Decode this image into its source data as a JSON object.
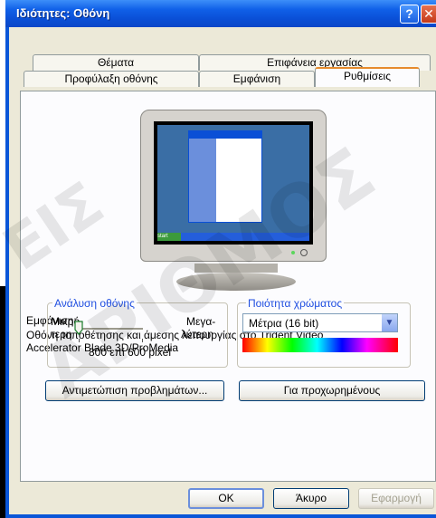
{
  "window": {
    "title": "Ιδιότητες: Οθόνη",
    "help_glyph": "?",
    "close_glyph": "✕"
  },
  "tabs": {
    "row1": [
      "Θέματα",
      "Επιφάνεια εργασίας"
    ],
    "row2": [
      "Προφύλαξη οθόνης",
      "Εμφάνιση",
      "Ρυθμίσεις"
    ],
    "active": "Ρυθμίσεις"
  },
  "display": {
    "label": "Εμφάνιση:",
    "description_line1": "Οθόνη τοποθέτησης και άμεσης λειτουργίας στο Trident Video",
    "description_line2": "Accelerator Blade 3D/ProMedia"
  },
  "resolution": {
    "group_label": "Ανάλυση οθόνης",
    "less_label_1": "Μικρό-",
    "less_label_2": "τερη",
    "more_label_1": "Μεγα-",
    "more_label_2": "λύτερη",
    "value": "800 επί 600 pixel",
    "slider_level": 0.0
  },
  "color": {
    "group_label": "Ποιότητα χρώματος",
    "selected": "Μέτρια (16 bit)"
  },
  "buttons": {
    "troubleshoot": "Αντιμετώπιση προβλημάτων...",
    "advanced": "Για προχωρημένους",
    "ok": "OK",
    "cancel": "Άκυρο",
    "apply": "Εφαρμογή"
  },
  "watermark": {
    "line1": "ΕΙΣ",
    "line2": "ΑΡΙΘΜΟΣ"
  },
  "preview": {
    "start_label": "start"
  },
  "colors": {
    "title_bar": "#0a56d8",
    "dialog_bg": "#ece9d8",
    "accent_tab": "#e68b2c"
  }
}
